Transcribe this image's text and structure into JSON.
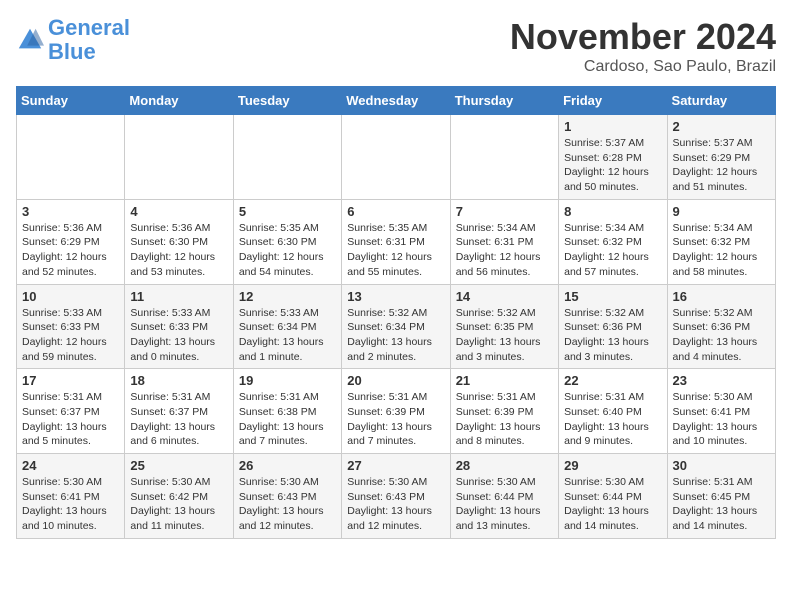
{
  "logo": {
    "line1": "General",
    "line2": "Blue"
  },
  "title": "November 2024",
  "location": "Cardoso, Sao Paulo, Brazil",
  "headers": [
    "Sunday",
    "Monday",
    "Tuesday",
    "Wednesday",
    "Thursday",
    "Friday",
    "Saturday"
  ],
  "weeks": [
    [
      {
        "day": "",
        "info": ""
      },
      {
        "day": "",
        "info": ""
      },
      {
        "day": "",
        "info": ""
      },
      {
        "day": "",
        "info": ""
      },
      {
        "day": "",
        "info": ""
      },
      {
        "day": "1",
        "info": "Sunrise: 5:37 AM\nSunset: 6:28 PM\nDaylight: 12 hours\nand 50 minutes."
      },
      {
        "day": "2",
        "info": "Sunrise: 5:37 AM\nSunset: 6:29 PM\nDaylight: 12 hours\nand 51 minutes."
      }
    ],
    [
      {
        "day": "3",
        "info": "Sunrise: 5:36 AM\nSunset: 6:29 PM\nDaylight: 12 hours\nand 52 minutes."
      },
      {
        "day": "4",
        "info": "Sunrise: 5:36 AM\nSunset: 6:30 PM\nDaylight: 12 hours\nand 53 minutes."
      },
      {
        "day": "5",
        "info": "Sunrise: 5:35 AM\nSunset: 6:30 PM\nDaylight: 12 hours\nand 54 minutes."
      },
      {
        "day": "6",
        "info": "Sunrise: 5:35 AM\nSunset: 6:31 PM\nDaylight: 12 hours\nand 55 minutes."
      },
      {
        "day": "7",
        "info": "Sunrise: 5:34 AM\nSunset: 6:31 PM\nDaylight: 12 hours\nand 56 minutes."
      },
      {
        "day": "8",
        "info": "Sunrise: 5:34 AM\nSunset: 6:32 PM\nDaylight: 12 hours\nand 57 minutes."
      },
      {
        "day": "9",
        "info": "Sunrise: 5:34 AM\nSunset: 6:32 PM\nDaylight: 12 hours\nand 58 minutes."
      }
    ],
    [
      {
        "day": "10",
        "info": "Sunrise: 5:33 AM\nSunset: 6:33 PM\nDaylight: 12 hours\nand 59 minutes."
      },
      {
        "day": "11",
        "info": "Sunrise: 5:33 AM\nSunset: 6:33 PM\nDaylight: 13 hours\nand 0 minutes."
      },
      {
        "day": "12",
        "info": "Sunrise: 5:33 AM\nSunset: 6:34 PM\nDaylight: 13 hours\nand 1 minute."
      },
      {
        "day": "13",
        "info": "Sunrise: 5:32 AM\nSunset: 6:34 PM\nDaylight: 13 hours\nand 2 minutes."
      },
      {
        "day": "14",
        "info": "Sunrise: 5:32 AM\nSunset: 6:35 PM\nDaylight: 13 hours\nand 3 minutes."
      },
      {
        "day": "15",
        "info": "Sunrise: 5:32 AM\nSunset: 6:36 PM\nDaylight: 13 hours\nand 3 minutes."
      },
      {
        "day": "16",
        "info": "Sunrise: 5:32 AM\nSunset: 6:36 PM\nDaylight: 13 hours\nand 4 minutes."
      }
    ],
    [
      {
        "day": "17",
        "info": "Sunrise: 5:31 AM\nSunset: 6:37 PM\nDaylight: 13 hours\nand 5 minutes."
      },
      {
        "day": "18",
        "info": "Sunrise: 5:31 AM\nSunset: 6:37 PM\nDaylight: 13 hours\nand 6 minutes."
      },
      {
        "day": "19",
        "info": "Sunrise: 5:31 AM\nSunset: 6:38 PM\nDaylight: 13 hours\nand 7 minutes."
      },
      {
        "day": "20",
        "info": "Sunrise: 5:31 AM\nSunset: 6:39 PM\nDaylight: 13 hours\nand 7 minutes."
      },
      {
        "day": "21",
        "info": "Sunrise: 5:31 AM\nSunset: 6:39 PM\nDaylight: 13 hours\nand 8 minutes."
      },
      {
        "day": "22",
        "info": "Sunrise: 5:31 AM\nSunset: 6:40 PM\nDaylight: 13 hours\nand 9 minutes."
      },
      {
        "day": "23",
        "info": "Sunrise: 5:30 AM\nSunset: 6:41 PM\nDaylight: 13 hours\nand 10 minutes."
      }
    ],
    [
      {
        "day": "24",
        "info": "Sunrise: 5:30 AM\nSunset: 6:41 PM\nDaylight: 13 hours\nand 10 minutes."
      },
      {
        "day": "25",
        "info": "Sunrise: 5:30 AM\nSunset: 6:42 PM\nDaylight: 13 hours\nand 11 minutes."
      },
      {
        "day": "26",
        "info": "Sunrise: 5:30 AM\nSunset: 6:43 PM\nDaylight: 13 hours\nand 12 minutes."
      },
      {
        "day": "27",
        "info": "Sunrise: 5:30 AM\nSunset: 6:43 PM\nDaylight: 13 hours\nand 12 minutes."
      },
      {
        "day": "28",
        "info": "Sunrise: 5:30 AM\nSunset: 6:44 PM\nDaylight: 13 hours\nand 13 minutes."
      },
      {
        "day": "29",
        "info": "Sunrise: 5:30 AM\nSunset: 6:44 PM\nDaylight: 13 hours\nand 14 minutes."
      },
      {
        "day": "30",
        "info": "Sunrise: 5:31 AM\nSunset: 6:45 PM\nDaylight: 13 hours\nand 14 minutes."
      }
    ]
  ]
}
